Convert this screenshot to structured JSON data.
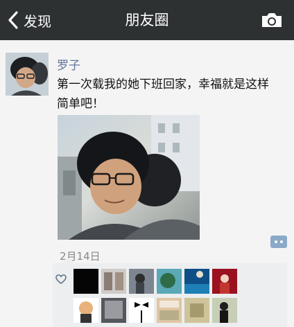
{
  "nav": {
    "back_label": "发现",
    "title": "朋友圈",
    "icons": [
      "chevron-left-icon",
      "camera-icon"
    ]
  },
  "post": {
    "username": "罗子",
    "text": "第一次载我的她下班回家，幸福就是这样简单吧！",
    "date": "2月14日"
  },
  "likes": {
    "icon": "heart-icon",
    "avatar_count": 12
  },
  "colors": {
    "nav_bg": "#2e3132",
    "name_link": "#60739a",
    "comment_button": "#8ba9c9",
    "likes_panel_bg": "#eceeef"
  }
}
